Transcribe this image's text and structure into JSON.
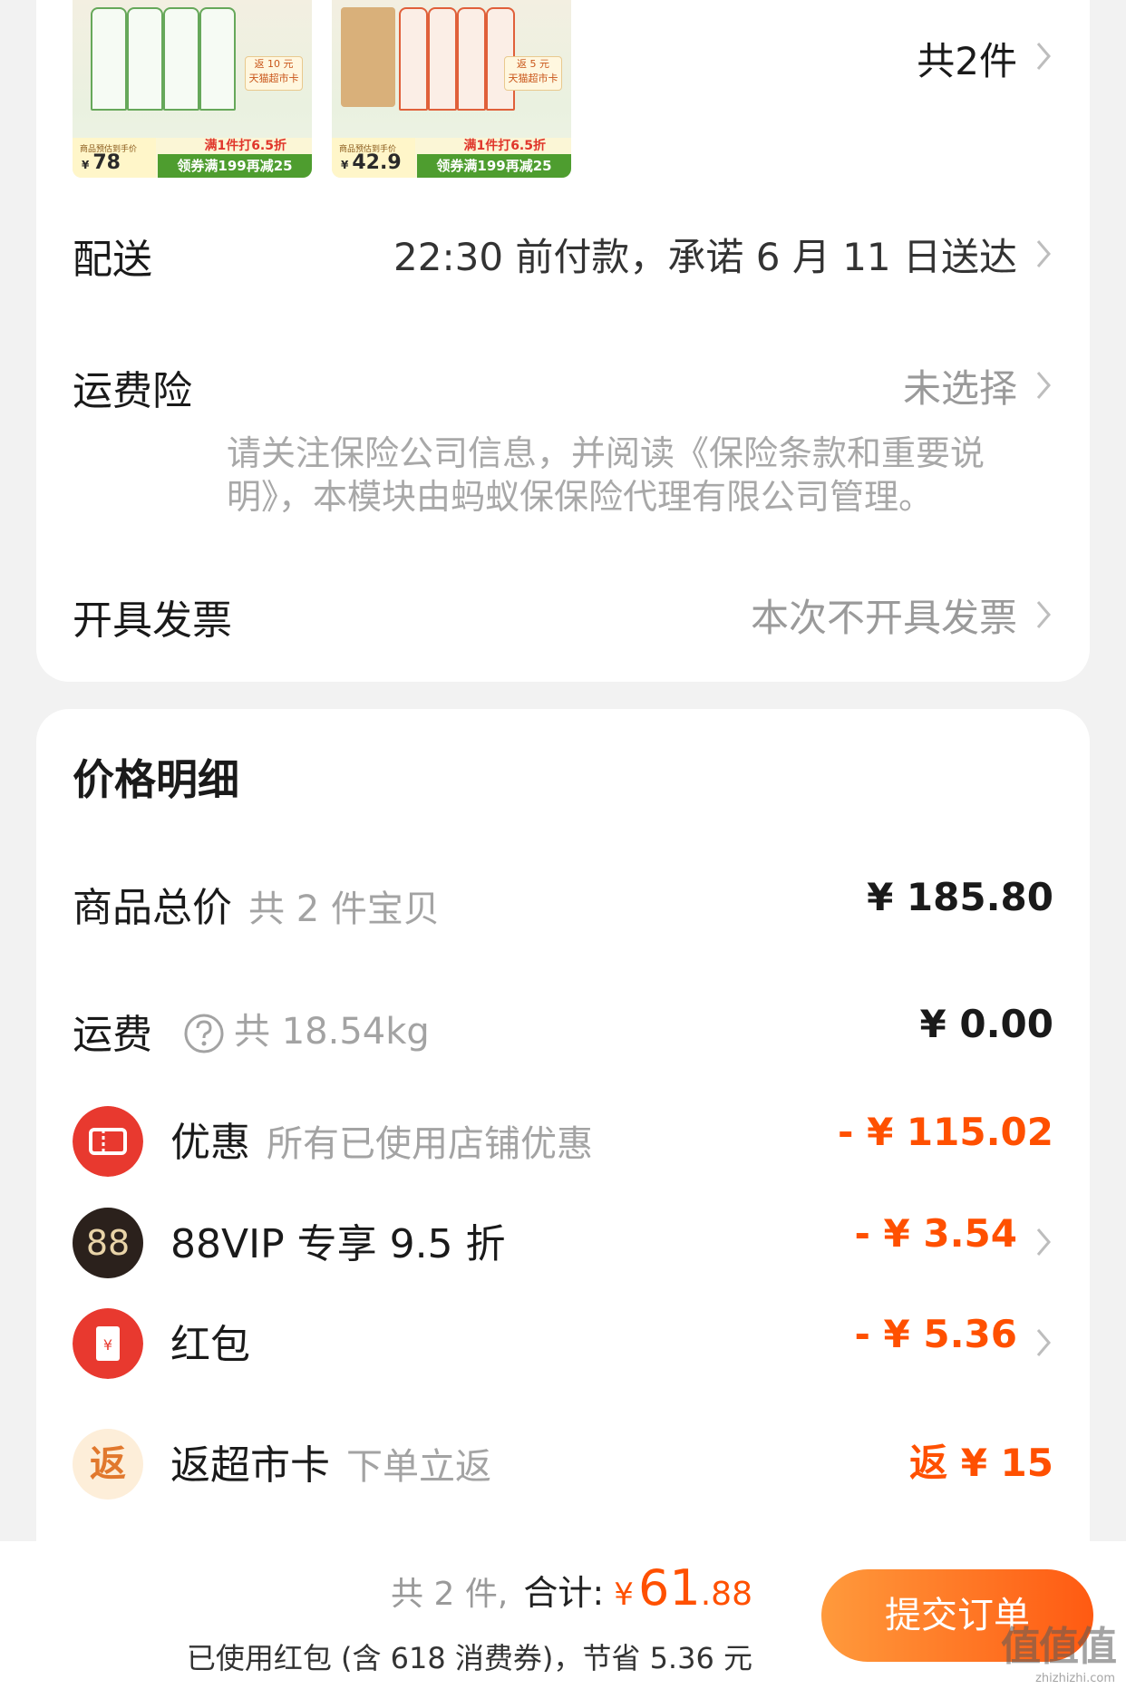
{
  "products": {
    "items": [
      {
        "price": "78",
        "currency": "¥",
        "price_label": "商品预估到手价",
        "promo_line1": "满1件打6.5折",
        "promo_line2": "领券满199再减25",
        "tag_line1": "返 10 元",
        "tag_line2": "天猫超市卡"
      },
      {
        "price": "42.9",
        "currency": "¥",
        "price_label": "商品预估到手价",
        "promo_line1": "满1件打6.5折",
        "promo_line2": "领券满199再减25",
        "tag_line1": "返 5 元",
        "tag_line2": "天猫超市卡"
      }
    ],
    "count_text": "共2件"
  },
  "delivery": {
    "label": "配送",
    "value": "22:30 前付款，承诺 6 月 11 日送达"
  },
  "insurance": {
    "label": "运费险",
    "value": "未选择",
    "note_line1": "请关注保险公司信息，并阅读《保险条款和重要说",
    "note_line2": "明》，本模块由蚂蚁保保险代理有限公司管理。"
  },
  "invoice": {
    "label": "开具发票",
    "value": "本次不开具发票"
  },
  "price_detail": {
    "title": "价格明细",
    "goods_total": {
      "label": "商品总价",
      "sub": "共 2 件宝贝",
      "value": "¥ 185.80"
    },
    "shipping": {
      "label": "运费",
      "sub": "共 18.54kg",
      "value": "¥ 0.00"
    },
    "discount": {
      "label": "优惠",
      "sub": "所有已使用店铺优惠",
      "value": "- ¥ 115.02"
    },
    "vip": {
      "icon_text": "88",
      "label": "88VIP 专享 9.5 折",
      "value": "- ¥ 3.54"
    },
    "red_packet": {
      "label": "红包",
      "value": "- ¥ 5.36"
    },
    "cashback": {
      "icon_text": "返",
      "label": "返超市卡",
      "sub": "下单立返",
      "value": "返 ¥ 15"
    }
  },
  "footer": {
    "count": "共 2 件,",
    "total_label": "合计:",
    "currency": "¥",
    "total_int": "61",
    "total_dec": ".88",
    "savings": "已使用红包 (含 618 消费券)，节省 5.36 元",
    "submit_label": "提交订单",
    "watermark_text": "值值值",
    "watermark_site": "zhizhizhi.com"
  },
  "colors": {
    "accent": "#ff5000",
    "red_icon": "#e8392f",
    "vip_icon": "#2b211c",
    "card_bg": "#ffffff",
    "page_bg": "#f2f2f2"
  }
}
